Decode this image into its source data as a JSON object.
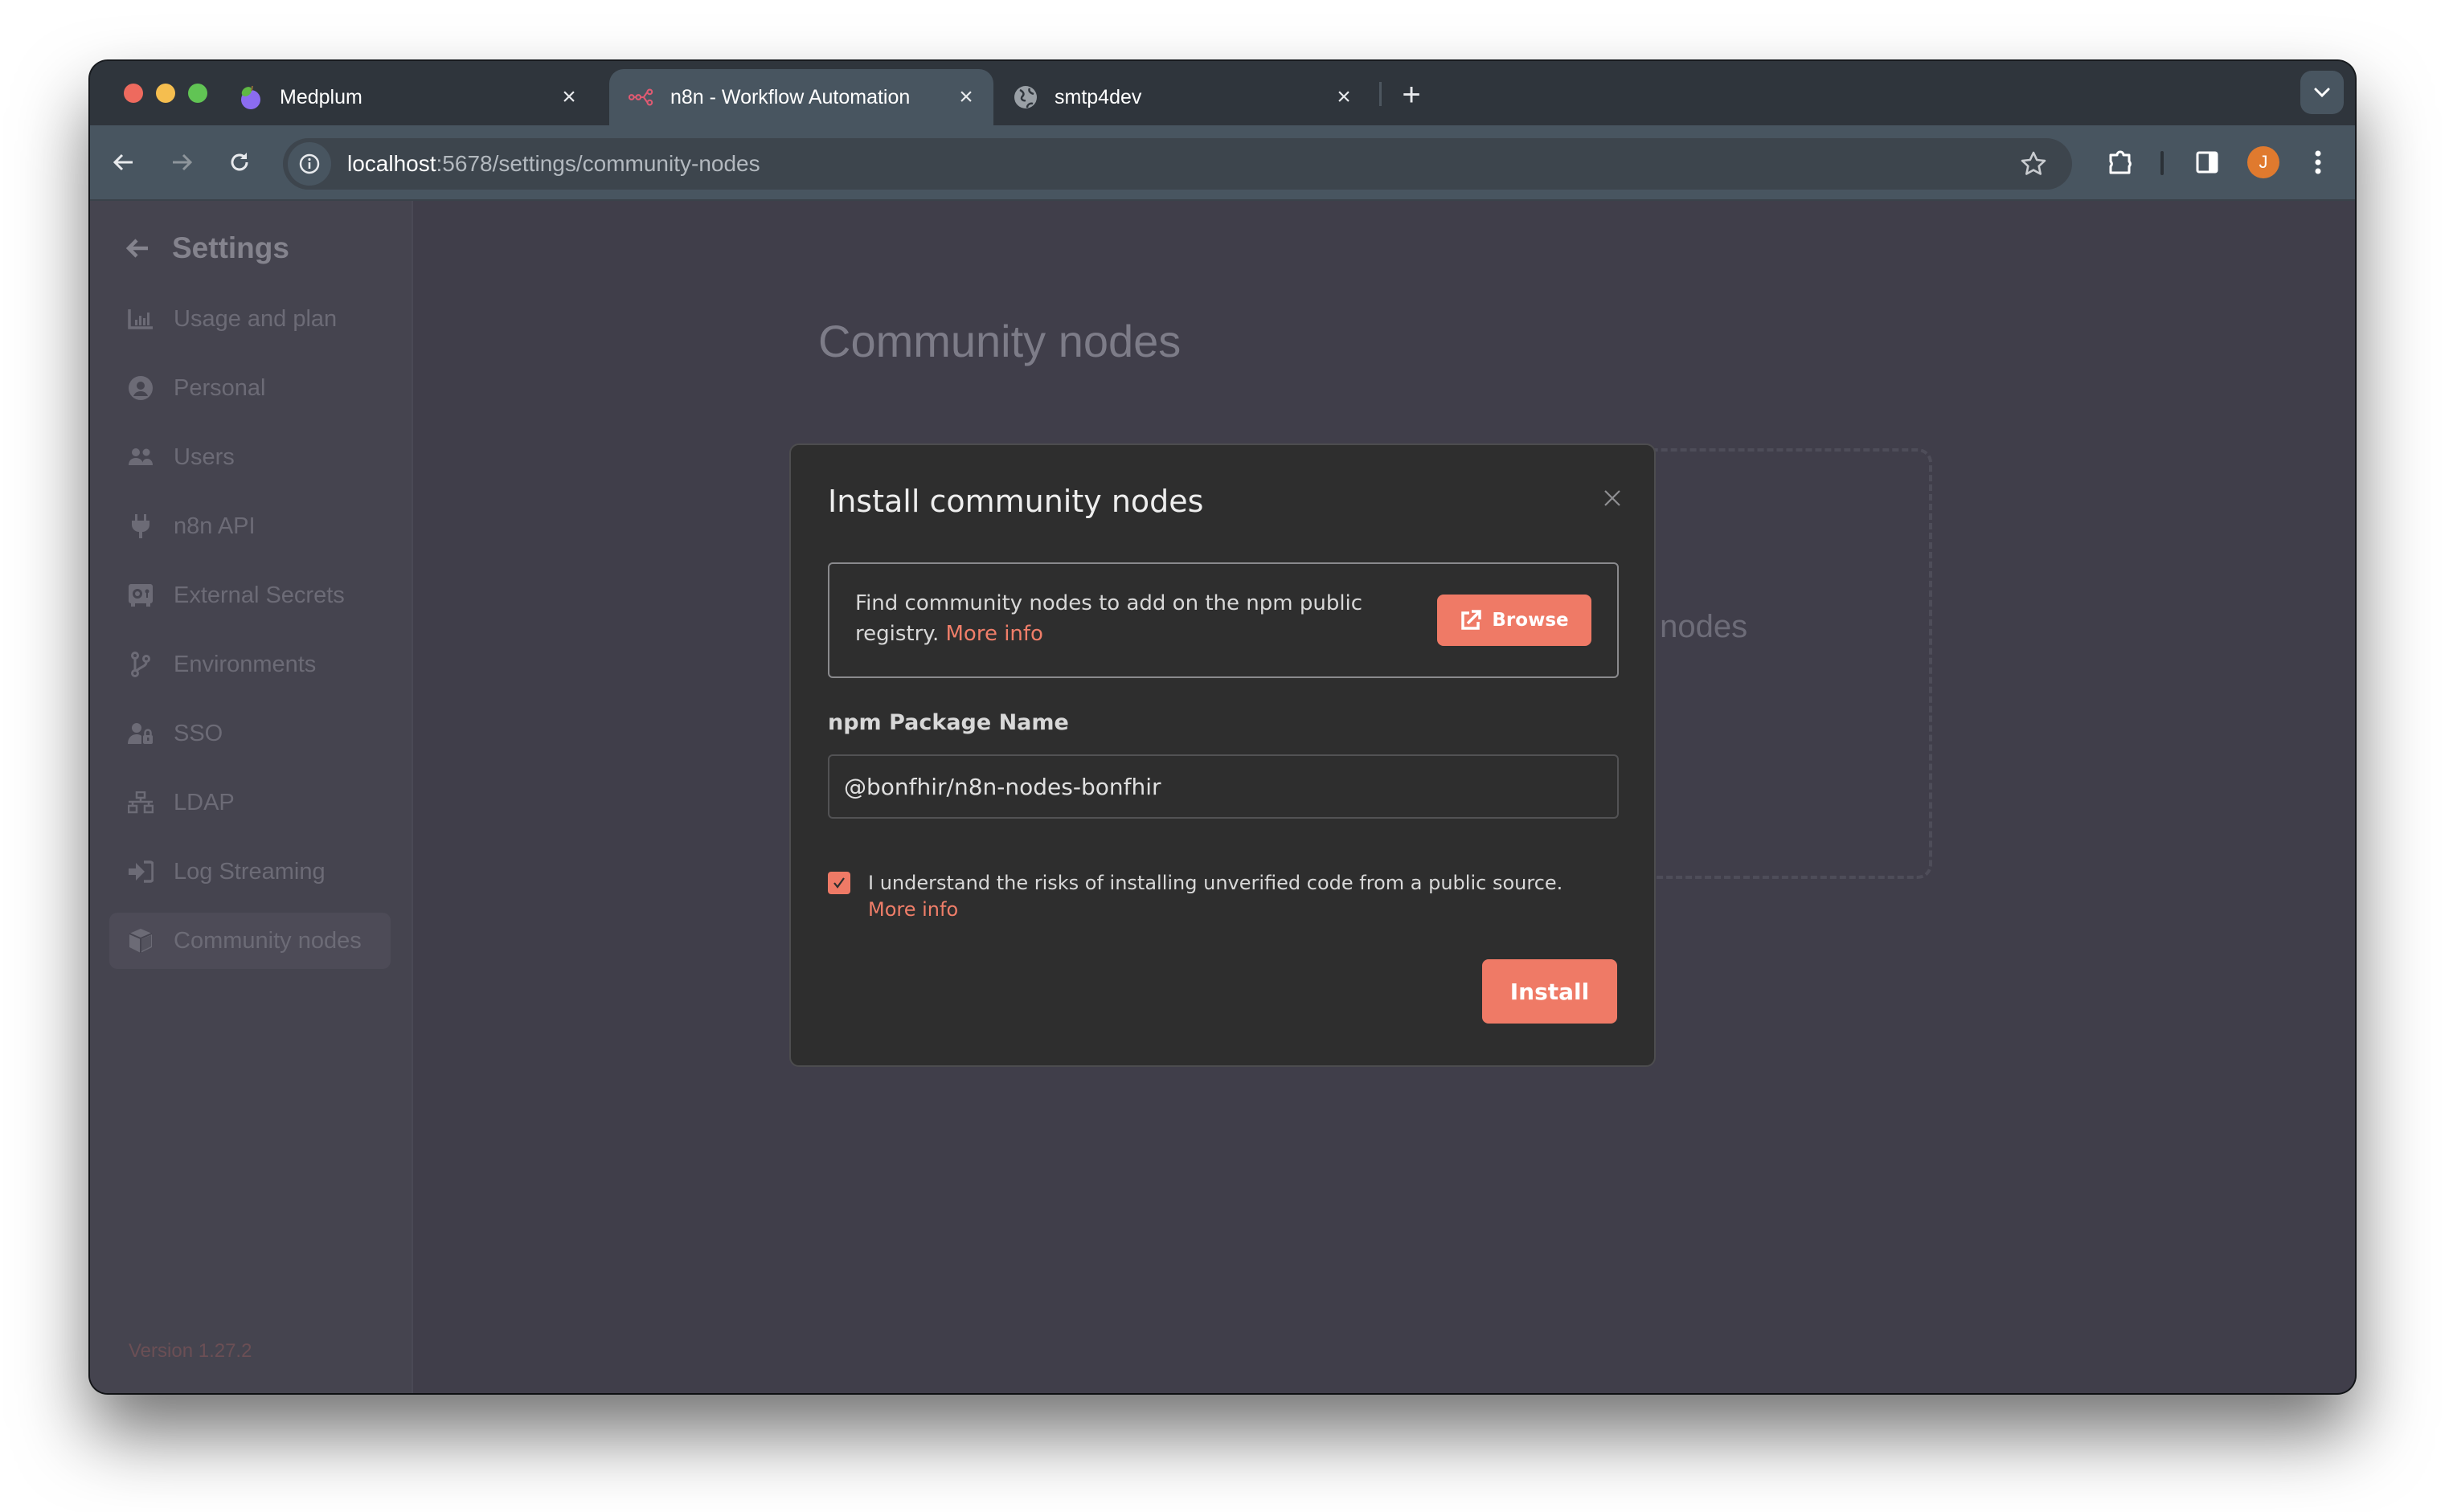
{
  "browser": {
    "tabs": [
      {
        "title": "Medplum",
        "icon": "plum-icon",
        "active": false
      },
      {
        "title": "n8n - Workflow Automation",
        "icon": "n8n-logo-icon",
        "active": true
      },
      {
        "title": "smtp4dev",
        "icon": "globe-icon",
        "active": false
      }
    ],
    "url_host": "localhost",
    "url_path": ":5678/settings/community-nodes",
    "avatar_initial": "J",
    "colors": {
      "avatar": "#e07a2e"
    }
  },
  "sidebar": {
    "title": "Settings",
    "items": [
      {
        "label": "Usage and plan",
        "icon": "bar-chart-icon"
      },
      {
        "label": "Personal",
        "icon": "user-circle-icon"
      },
      {
        "label": "Users",
        "icon": "users-icon"
      },
      {
        "label": "n8n API",
        "icon": "plug-icon"
      },
      {
        "label": "External Secrets",
        "icon": "vault-icon"
      },
      {
        "label": "Environments",
        "icon": "git-branch-icon"
      },
      {
        "label": "SSO",
        "icon": "user-lock-icon"
      },
      {
        "label": "LDAP",
        "icon": "network-icon"
      },
      {
        "label": "Log Streaming",
        "icon": "sign-in-icon"
      },
      {
        "label": "Community nodes",
        "icon": "cube-icon",
        "active": true
      }
    ],
    "version": "Version 1.27.2"
  },
  "main": {
    "title": "Community nodes",
    "empty_state_text": "y nodes"
  },
  "modal": {
    "title": "Install community nodes",
    "info_text": "Find community nodes to add on the npm public registry. ",
    "info_link": "More info",
    "browse_label": "Browse",
    "package_label": "npm Package Name",
    "package_value": "@bonfhir/n8n-nodes-bonfhir",
    "checkbox_checked": true,
    "checkbox_label": "I understand the risks of installing unverified code from a public source.",
    "checkbox_link": "More info",
    "install_label": "Install",
    "colors": {
      "accent": "#ef7a66"
    }
  }
}
